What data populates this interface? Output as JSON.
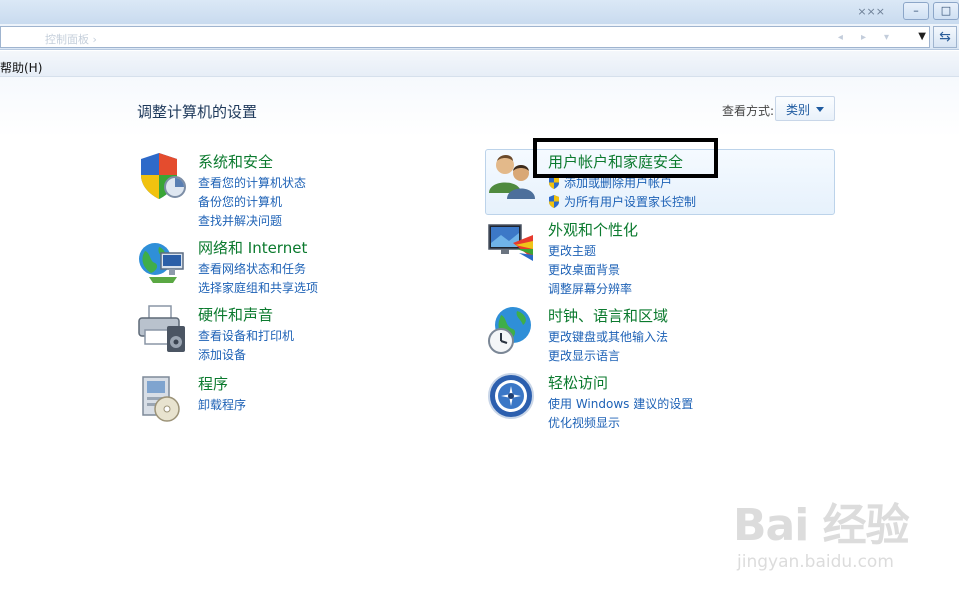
{
  "window": {
    "caption_faint": "×××",
    "controls": [
      "–",
      "□"
    ]
  },
  "addressbar": {
    "path_faint": "控制面板 ›",
    "faint_tools": [
      "◂",
      "▸",
      "▾"
    ],
    "refresh_icon": "refresh-icon"
  },
  "menubar": {
    "help_label": "帮助(H)"
  },
  "page": {
    "title": "调整计算机的设置",
    "view_label": "查看方式:",
    "view_value": "类别"
  },
  "categories": {
    "left": [
      {
        "title": "系统和安全",
        "icon": "shield-icon",
        "links": [
          "查看您的计算机状态",
          "备份您的计算机",
          "查找并解决问题"
        ]
      },
      {
        "title": "网络和 Internet",
        "icon": "network-icon",
        "links": [
          "查看网络状态和任务",
          "选择家庭组和共享选项"
        ]
      },
      {
        "title": "硬件和声音",
        "icon": "printer-icon",
        "links": [
          "查看设备和打印机",
          "添加设备"
        ]
      },
      {
        "title": "程序",
        "icon": "programs-icon",
        "links": [
          "卸载程序"
        ]
      }
    ],
    "right": [
      {
        "title": "用户帐户和家庭安全",
        "icon": "users-icon",
        "links": [
          "添加或删除用户帐户",
          "为所有用户设置家长控制"
        ]
      },
      {
        "title": "外观和个性化",
        "icon": "display-icon",
        "links": [
          "更改主题",
          "更改桌面背景",
          "调整屏幕分辨率"
        ]
      },
      {
        "title": "时钟、语言和区域",
        "icon": "globe-clock-icon",
        "links": [
          "更改键盘或其他输入法",
          "更改显示语言"
        ]
      },
      {
        "title": "轻松访问",
        "icon": "ease-of-access-icon",
        "links": [
          "使用 Windows 建议的设置",
          "优化视频显示"
        ]
      }
    ]
  },
  "watermark": {
    "brand": "Bai 经验",
    "url": "jingyan.baidu.com"
  },
  "colors": {
    "category_title": "#0b7a2e",
    "link": "#1e62b6",
    "annotation_box": "#000000"
  }
}
